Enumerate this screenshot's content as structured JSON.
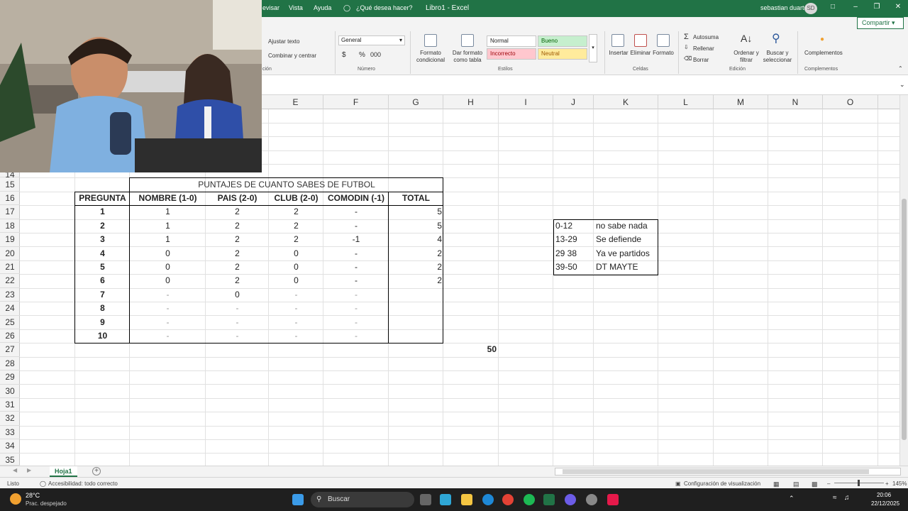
{
  "titlebar": {
    "menu": [
      "evisar",
      "Vista",
      "Ayuda"
    ],
    "tell_me": "¿Qué desea hacer?",
    "title": "Libro1 - Excel",
    "user": "sebastian duarte",
    "avatar": "SD",
    "share": "Compartir"
  },
  "ribbon": {
    "wrap_text": "Ajustar texto",
    "merge_center": "Combinar y centrar",
    "alignment_group": "ción",
    "number_format": "General",
    "number_group": "Número",
    "conditional_format": "Formato condicional",
    "format_table": "Dar formato como tabla",
    "styles": {
      "normal": "Normal",
      "good": "Bueno",
      "bad": "Incorrecto",
      "neutral": "Neutral"
    },
    "styles_group": "Estilos",
    "insert": "Insertar",
    "delete": "Eliminar",
    "format": "Formato",
    "cells_group": "Celdas",
    "autosum": "Autosuma",
    "fill": "Rellenar",
    "clear": "Borrar",
    "sort_filter": "Ordenar y filtrar",
    "find_select": "Buscar y seleccionar",
    "editing_group": "Edición",
    "addins": "Complementos",
    "addins_group": "Complementos"
  },
  "grid": {
    "columns": [
      "E",
      "F",
      "G",
      "H",
      "I",
      "J",
      "K",
      "L",
      "M",
      "N",
      "O"
    ],
    "rows": [
      "14",
      "15",
      "16",
      "17",
      "18",
      "19",
      "20",
      "21",
      "22",
      "23",
      "24",
      "25",
      "26",
      "27",
      "28",
      "29",
      "30",
      "31",
      "32",
      "33",
      "34",
      "35"
    ]
  },
  "table": {
    "title": "PUNTAJES DE CUANTO SABES DE FUTBOL",
    "headers": [
      "PREGUNTA",
      "NOMBRE (1-0)",
      "PAIS (2-0)",
      "CLUB (2-0)",
      "COMODIN (-1)",
      "TOTAL"
    ],
    "rows": [
      [
        "1",
        "1",
        "2",
        "2",
        "-",
        "5"
      ],
      [
        "2",
        "1",
        "2",
        "2",
        "-",
        "5"
      ],
      [
        "3",
        "1",
        "2",
        "2",
        "-1",
        "4"
      ],
      [
        "4",
        "0",
        "2",
        "0",
        "-",
        "2"
      ],
      [
        "5",
        "0",
        "2",
        "0",
        "-",
        "2"
      ],
      [
        "6",
        "0",
        "2",
        "0",
        "-",
        "2"
      ],
      [
        "7",
        "-",
        "0",
        "-",
        "-",
        ""
      ],
      [
        "8",
        "-",
        "-",
        "-",
        "-",
        ""
      ],
      [
        "9",
        "-",
        "-",
        "-",
        "-",
        ""
      ],
      [
        "10",
        "-",
        "-",
        "-",
        "-",
        ""
      ]
    ],
    "grand_total": "50"
  },
  "legend": [
    [
      "0-12",
      "no sabe nada"
    ],
    [
      "13-29",
      "Se defiende"
    ],
    [
      "29 38",
      "Ya ve partidos"
    ],
    [
      "39-50",
      "DT MAYTE"
    ]
  ],
  "sheets": {
    "active": "Hoja1"
  },
  "status": {
    "ready": "Listo",
    "accessibility": "Accesibilidad: todo correcto",
    "display_settings": "Configuración de visualización",
    "zoom": "145%"
  },
  "taskbar": {
    "temperature": "28°C",
    "weather": "Prac. despejado",
    "search": "Buscar",
    "time": "20:06",
    "date": "22/12/2025"
  }
}
